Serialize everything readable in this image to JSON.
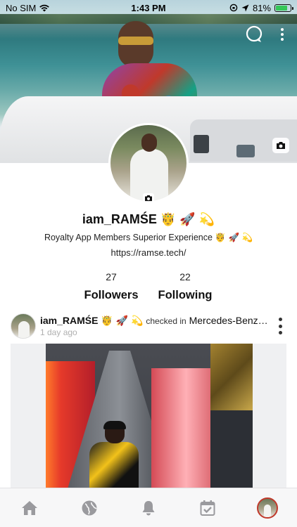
{
  "status_bar": {
    "carrier": "No SIM",
    "time": "1:43 PM",
    "battery_percent": "81%",
    "battery_level": 0.81
  },
  "cover": {
    "chat_icon": "chat-bubble-icon",
    "more_icon": "more-vertical-icon",
    "camera_icon": "camera-icon"
  },
  "profile": {
    "username": "iam_RAMŚE 🤴 🚀 💫",
    "bio": "Royalty App Members Superior Experience 🤴 🚀 💫",
    "link": "https://ramse.tech/",
    "avatar_camera_icon": "camera-icon"
  },
  "stats": {
    "followers_count": "27",
    "followers_label": "Followers",
    "following_count": "22",
    "following_label": "Following"
  },
  "post": {
    "author": "iam_RAMŚE 🤴 🚀 💫",
    "checked_in_text": "checked in",
    "place": "Mercedes-Benz…",
    "time_ago": "1 day ago"
  },
  "tab_bar": {
    "items": [
      {
        "icon": "home-icon"
      },
      {
        "icon": "globe-icon"
      },
      {
        "icon": "bell-icon"
      },
      {
        "icon": "calendar-check-icon"
      },
      {
        "icon": "profile-avatar"
      }
    ],
    "active_color": "#c0392b",
    "icon_color": "#9a9a9e"
  }
}
